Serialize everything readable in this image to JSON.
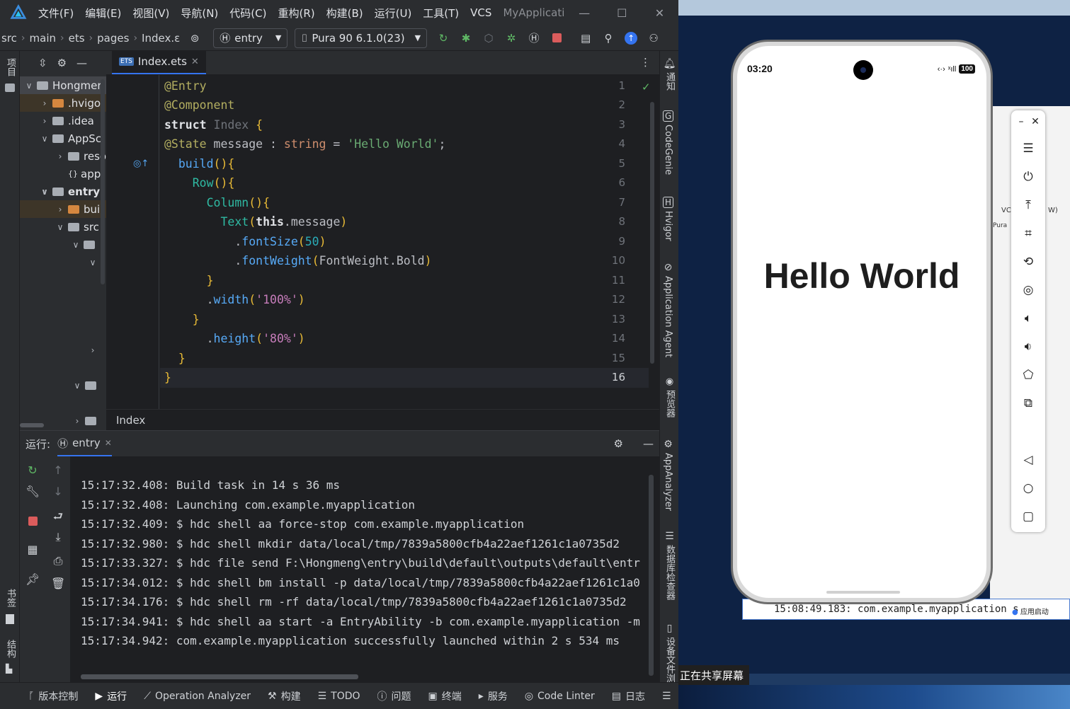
{
  "menubar": {
    "menus": [
      "文件(F)",
      "编辑(E)",
      "视图(V)",
      "导航(N)",
      "代码(C)",
      "重构(R)",
      "构建(B)",
      "运行(U)",
      "工具(T)",
      "VCS"
    ],
    "app_title": "MyApplicatio",
    "window_controls": [
      "—",
      "☐",
      "✕"
    ]
  },
  "toolbar": {
    "breadcrumbs": [
      "src",
      "main",
      "ets",
      "pages",
      "Index.ε"
    ],
    "run_config": "entry",
    "device": "Pura 90 6.1.0(23)"
  },
  "left_strip": {
    "project_label": "项目",
    "bookmarks_label": "书签",
    "structure_label": "结构"
  },
  "project": {
    "tree": [
      {
        "label": "Hongmer",
        "caret": "∨",
        "icon": "module",
        "selected": true
      },
      {
        "label": ".hvigo",
        "caret": "›",
        "icon": "folder-orange"
      },
      {
        "label": ".idea",
        "caret": "›",
        "icon": "folder"
      },
      {
        "label": "AppSc",
        "caret": "∨",
        "icon": "folder"
      },
      {
        "label": "reso",
        "caret": "›",
        "icon": "folder"
      },
      {
        "label": "app",
        "caret": "",
        "icon": "file"
      },
      {
        "label": "entry",
        "caret": "∨",
        "icon": "module"
      },
      {
        "label": "bui",
        "caret": "›",
        "icon": "folder-orange"
      },
      {
        "label": "src",
        "caret": "∨",
        "icon": "folder"
      },
      {
        "label": "",
        "caret": "∨",
        "icon": "folder"
      },
      {
        "label": "",
        "caret": "∨",
        "icon": ""
      }
    ]
  },
  "editor": {
    "tab_label": "Index.ets",
    "line_numbers": [
      "1",
      "2",
      "3",
      "4",
      "5",
      "6",
      "7",
      "8",
      "9",
      "10",
      "11",
      "12",
      "13",
      "14",
      "15",
      "16"
    ],
    "breadcrumb": "Index"
  },
  "run_panel": {
    "title": "运行:",
    "tab": "entry",
    "log": [
      "15:17:32.408: Build task in 14 s 36 ms",
      "15:17:32.408: Launching com.example.myapplication",
      "15:17:32.409: $ hdc shell aa force-stop com.example.myapplication",
      "15:17:32.980: $ hdc shell mkdir data/local/tmp/7839a5800cfb4a22aef1261c1a0735d2",
      "15:17:33.327: $ hdc file send F:\\Hongmeng\\entry\\build\\default\\outputs\\default\\entr",
      "15:17:34.012: $ hdc shell bm install -p data/local/tmp/7839a5800cfb4a22aef1261c1a0",
      "15:17:34.176: $ hdc shell rm -rf data/local/tmp/7839a5800cfb4a22aef1261c1a0735d2",
      "15:17:34.941: $ hdc shell aa start -a EntryAbility -b com.example.myapplication -m",
      "15:17:34.942: com.example.myapplication successfully launched within 2 s 534 ms"
    ]
  },
  "right_strip": {
    "items": [
      "通知",
      "CodeGenie",
      "Hvigor",
      "Application Agent",
      "预览器",
      "AppAnalyzer",
      "数据库检查器",
      "设备文件浏"
    ]
  },
  "statusbar": {
    "items": [
      "版本控制",
      "运行",
      "Operation Analyzer",
      "构建",
      "TODO",
      "问题",
      "终端",
      "服务",
      "Code Linter",
      "日志"
    ]
  },
  "desktop": {
    "share_text": "正在共享屏幕",
    "console_text": "15:08:49.183: com.example.myapplication s",
    "badge_text": "应用启动",
    "behind_labels": {
      "vc": "VC",
      "w": "W)",
      "pura": "Pura"
    }
  },
  "phone": {
    "time": "03:20",
    "battery": "100",
    "hello_text": "Hello World"
  }
}
